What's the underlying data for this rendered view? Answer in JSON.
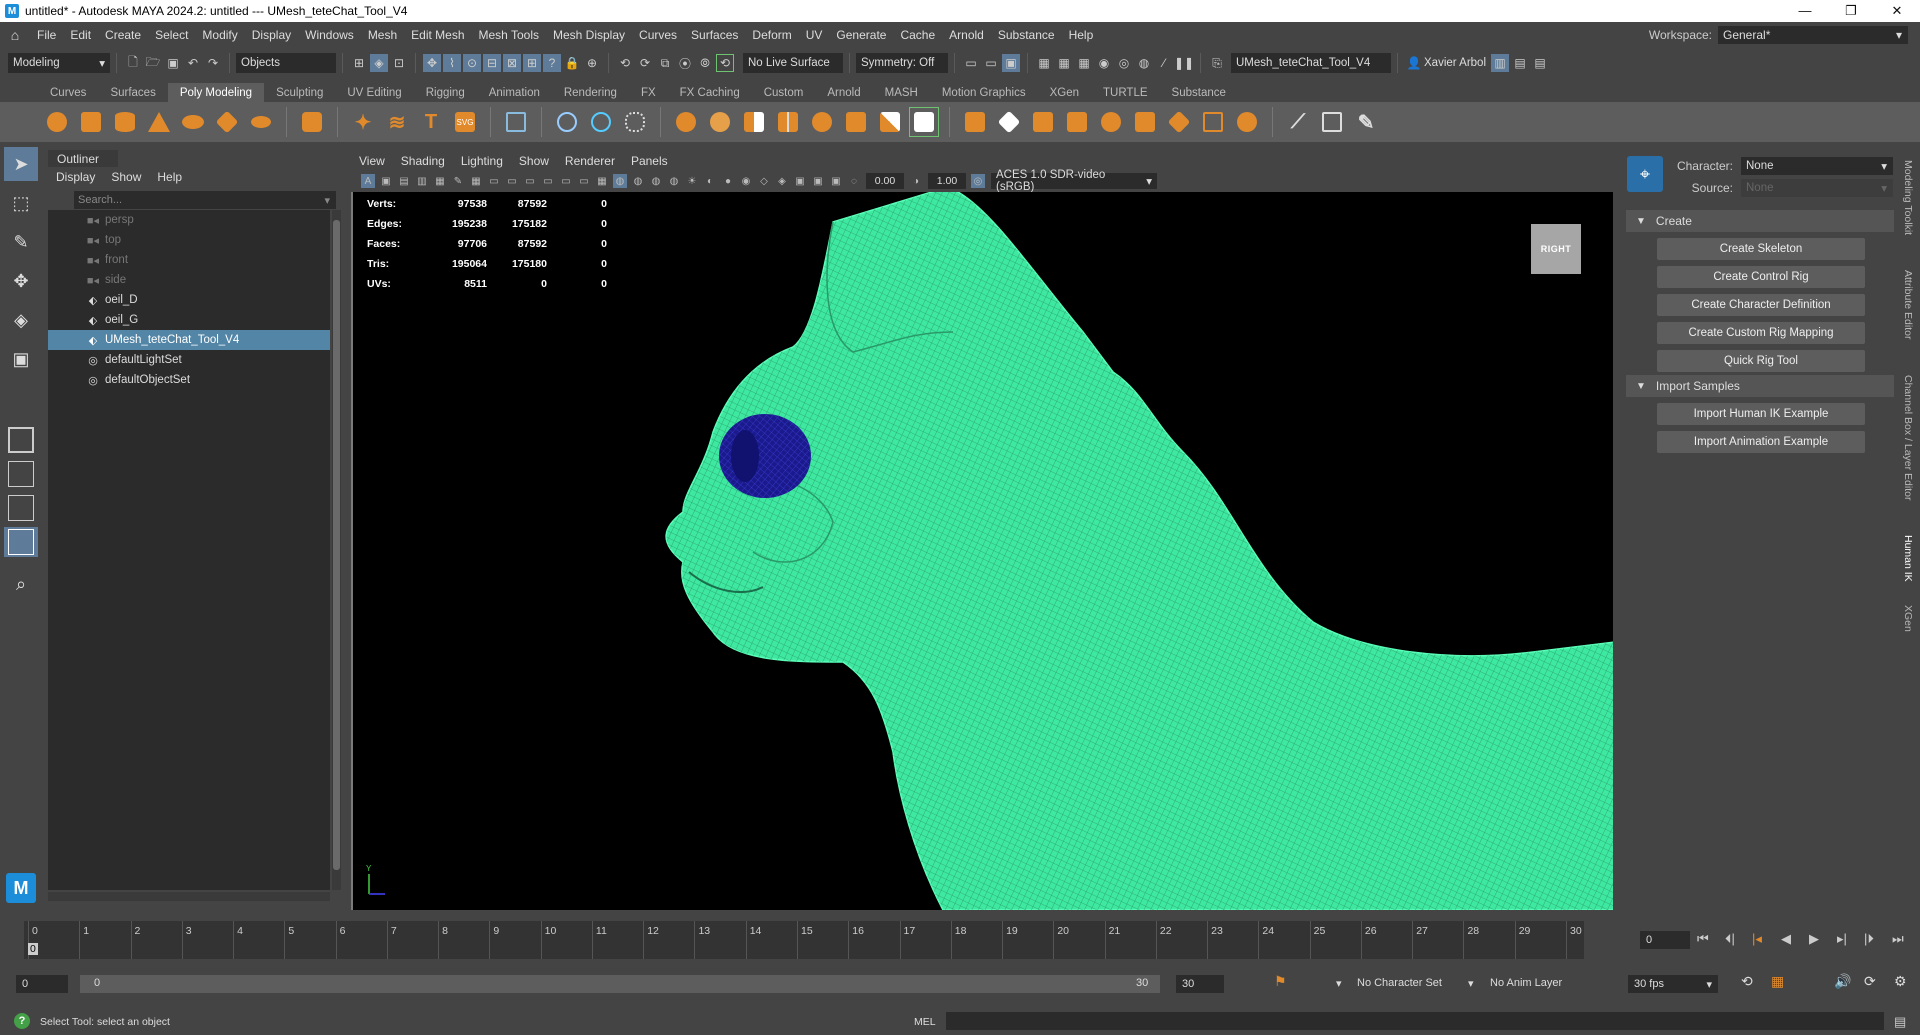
{
  "window": {
    "title": "untitled* - Autodesk MAYA 2024.2: untitled   ---   UMesh_teteChat_Tool_V4",
    "controls": [
      "—",
      "❐",
      "✕"
    ]
  },
  "menubar": {
    "items": [
      "File",
      "Edit",
      "Create",
      "Select",
      "Modify",
      "Display",
      "Windows",
      "Mesh",
      "Edit Mesh",
      "Mesh Tools",
      "Mesh Display",
      "Curves",
      "Surfaces",
      "Deform",
      "UV",
      "Generate",
      "Cache",
      "Arnold",
      "Substance",
      "Help"
    ],
    "workspace_label": "Workspace:",
    "workspace_value": "General*"
  },
  "statusline": {
    "menuset": "Modeling",
    "selection_mode": "Objects",
    "live_surface": "No Live Surface",
    "symmetry": "Symmetry: Off",
    "scene_name": "UMesh_teteChat_Tool_V4",
    "user": "Xavier Arbol"
  },
  "shelf": {
    "tabs": [
      "Curves",
      "Surfaces",
      "Poly Modeling",
      "Sculpting",
      "UV Editing",
      "Rigging",
      "Animation",
      "Rendering",
      "FX",
      "FX Caching",
      "Custom",
      "Arnold",
      "MASH",
      "Motion Graphics",
      "XGen",
      "TURTLE",
      "Substance"
    ],
    "active_tab": "Poly Modeling"
  },
  "outliner": {
    "title": "Outliner",
    "menu": [
      "Display",
      "Show",
      "Help"
    ],
    "search_placeholder": "Search...",
    "items": [
      {
        "label": "persp",
        "icon": "camera-icon",
        "dim": true,
        "selected": false
      },
      {
        "label": "top",
        "icon": "camera-icon",
        "dim": true,
        "selected": false
      },
      {
        "label": "front",
        "icon": "camera-icon",
        "dim": true,
        "selected": false
      },
      {
        "label": "side",
        "icon": "camera-icon",
        "dim": true,
        "selected": false
      },
      {
        "label": "oeil_D",
        "icon": "mesh-icon",
        "dim": false,
        "selected": false
      },
      {
        "label": "oeil_G",
        "icon": "mesh-icon",
        "dim": false,
        "selected": false
      },
      {
        "label": "UMesh_teteChat_Tool_V4",
        "icon": "mesh-icon",
        "dim": false,
        "selected": true
      },
      {
        "label": "defaultLightSet",
        "icon": "set-icon",
        "dim": false,
        "selected": false
      },
      {
        "label": "defaultObjectSet",
        "icon": "set-icon",
        "dim": false,
        "selected": false
      }
    ]
  },
  "viewport": {
    "menu": [
      "View",
      "Shading",
      "Lighting",
      "Show",
      "Renderer",
      "Panels"
    ],
    "near_value": "0.00",
    "far_value": "1.00",
    "color_space": "ACES 1.0 SDR-video (sRGB)",
    "viewcube_label": "RIGHT",
    "hud": [
      {
        "label": "Verts:",
        "a": "97538",
        "b": "87592",
        "c": "0"
      },
      {
        "label": "Edges:",
        "a": "195238",
        "b": "175182",
        "c": "0"
      },
      {
        "label": "Faces:",
        "a": "97706",
        "b": "87592",
        "c": "0"
      },
      {
        "label": "Tris:",
        "a": "195064",
        "b": "175180",
        "c": "0"
      },
      {
        "label": "UVs:",
        "a": "8511",
        "b": "0",
        "c": "0"
      }
    ],
    "mesh_color": "#3ee8a0",
    "eye_color": "#1a1a8c"
  },
  "hik": {
    "character_label": "Character:",
    "character_value": "None",
    "source_label": "Source:",
    "source_value": "None",
    "create_section": "Create",
    "create_buttons": [
      "Create Skeleton",
      "Create Control Rig",
      "Create Character Definition",
      "Create Custom Rig Mapping",
      "Quick Rig Tool"
    ],
    "import_section": "Import Samples",
    "import_buttons": [
      "Import Human IK Example",
      "Import Animation Example"
    ],
    "side_tabs": [
      "Modeling Toolkit",
      "Attribute Editor",
      "Channel Box / Layer Editor",
      "Human IK",
      "XGen"
    ]
  },
  "timeline": {
    "frames": [
      0,
      1,
      2,
      3,
      4,
      5,
      6,
      7,
      8,
      9,
      10,
      11,
      12,
      13,
      14,
      15,
      16,
      17,
      18,
      19,
      20,
      21,
      22,
      23,
      24,
      25,
      26,
      27,
      28,
      29,
      30
    ],
    "current_frame": "0",
    "playhead_label": "0"
  },
  "range": {
    "start": "0",
    "inner_start": "0",
    "inner_end": "30",
    "end": "30",
    "character_set": "No Character Set",
    "anim_layer": "No Anim Layer",
    "fps": "30 fps"
  },
  "cmdline": {
    "help_text": "Select Tool: select an object",
    "mel_label": "MEL"
  }
}
